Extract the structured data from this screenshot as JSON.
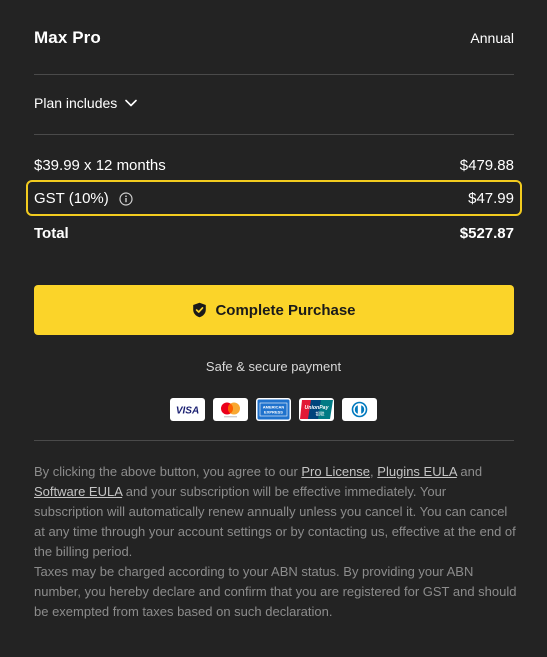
{
  "plan": {
    "name": "Max Pro",
    "billing_cycle": "Annual",
    "includes_label": "Plan includes"
  },
  "summary": {
    "subscription_label": "$39.99 x 12 months",
    "subscription_amount": "$479.88",
    "tax_label": "GST (10%)",
    "tax_amount": "$47.99",
    "total_label": "Total",
    "total_amount": "$527.87"
  },
  "purchase": {
    "button_label": "Complete Purchase",
    "secure_text": "Safe & secure payment"
  },
  "payment_methods": [
    "visa-card-icon",
    "mastercard-icon",
    "american-express-icon",
    "unionpay-icon",
    "diners-club-icon"
  ],
  "card_labels": {
    "visa": "VISA",
    "amex": "AMERICAN EXPRESS",
    "unionpay": "UnionPay",
    "unionpay_cn": "银联"
  },
  "legal": {
    "part1": "By clicking the above button, you agree to our ",
    "pro_license": "Pro License",
    "comma": ", ",
    "plugins_eula": "Plugins EULA",
    "and": " and ",
    "software_eula": "Software EULA",
    "part2": " and your subscription will be effective immediately. Your subscription will automatically renew annually unless you cancel it. You can cancel at any time through your account settings or by contacting us, effective at the end of the billing period.",
    "part3": "Taxes may be charged according to your ABN status. By providing your ABN number, you hereby declare and confirm that you are registered for GST and should be exempted from taxes based on such declaration."
  },
  "colors": {
    "background": "#232323",
    "accent": "#fbd429",
    "highlight_border": "#f2cb1f",
    "legal_text": "#8c8c8c"
  }
}
